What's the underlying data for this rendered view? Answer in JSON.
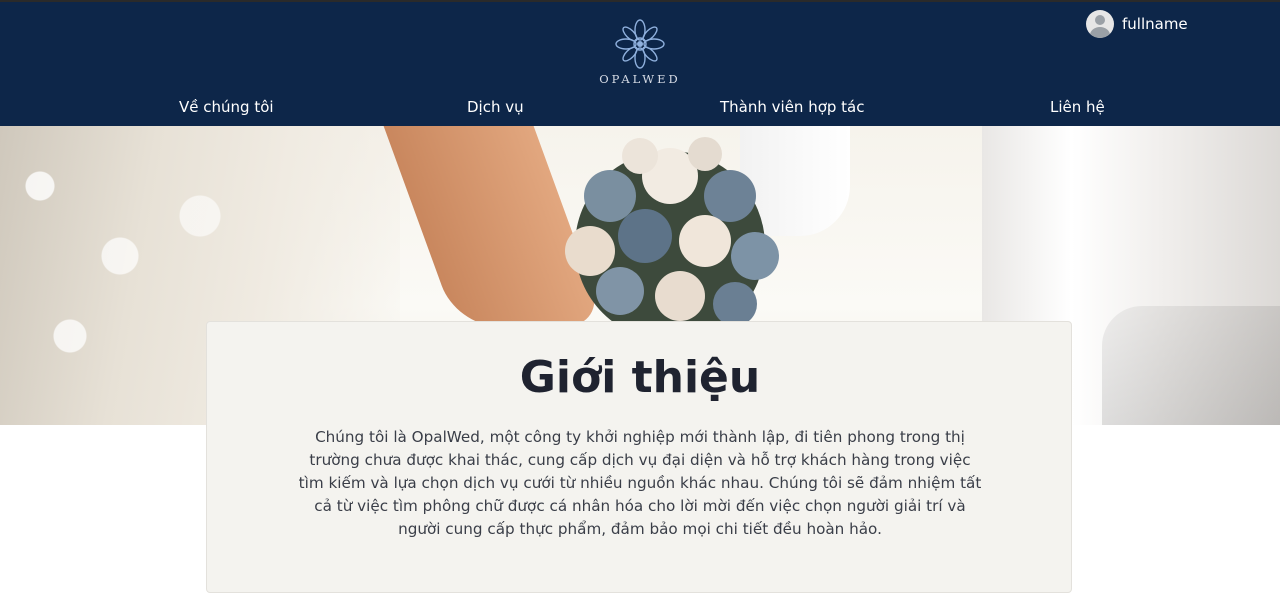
{
  "header": {
    "logo_text": "OPALWED",
    "user": {
      "name": "fullname",
      "avatar_icon": "user-avatar-icon"
    },
    "nav": [
      {
        "label": "Về chúng tôi"
      },
      {
        "label": "Dịch vụ"
      },
      {
        "label": "Thành viên hợp tác"
      },
      {
        "label": "Liên hệ"
      }
    ]
  },
  "intro": {
    "title": "Giới thiệu",
    "body": "Chúng tôi là OpalWed, một công ty khởi nghiệp mới thành lập, đi tiên phong trong thị trường chưa được khai thác, cung cấp dịch vụ đại diện và hỗ trợ khách hàng trong việc tìm kiếm và lựa chọn dịch vụ cưới từ nhiều nguồn khác nhau. Chúng tôi sẽ đảm nhiệm tất cả từ việc tìm phông chữ được cá nhân hóa cho lời mời đến việc chọn người giải trí và người cung cấp thực phẩm, đảm bảo mọi chi tiết đều hoàn hảo."
  },
  "colors": {
    "header_bg": "#0d2649",
    "card_bg": "#f4f3ef",
    "title": "#1f2330"
  }
}
